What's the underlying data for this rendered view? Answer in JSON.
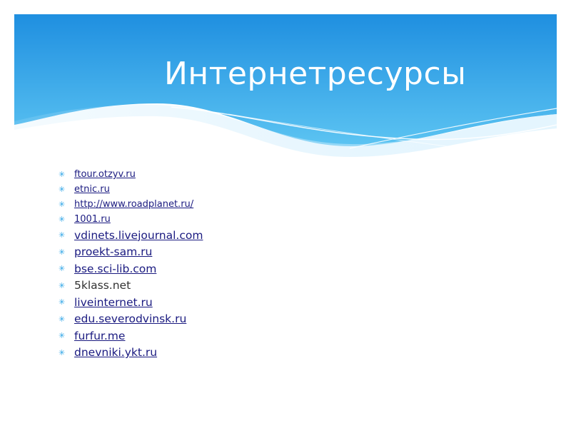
{
  "slide": {
    "title": "Интернетресурсы",
    "colors": {
      "header_top": "#1f8fe0",
      "header_bottom": "#5cc4f2",
      "bullet": "#29a3e6",
      "link": "#1a1a80"
    },
    "bullet_icon": "asterisk-bullet-icon",
    "links": [
      {
        "label": "ftour.otzyv.ru"
      },
      {
        "label": "etnic.ru"
      },
      {
        "label": "http://www.roadplanet.ru/"
      },
      {
        "label": "1001.ru"
      },
      {
        "label": "vdinets.livejournal.com"
      },
      {
        "label": "proekt-sam.ru"
      },
      {
        "label": "bse.sci-lib.com"
      },
      {
        "label": "5klass.net"
      },
      {
        "label": "liveinternet.ru"
      },
      {
        "label": "edu.severodvinsk.ru"
      },
      {
        "label": "furfur.me"
      },
      {
        "label": "dnevniki.ykt.ru"
      }
    ]
  }
}
